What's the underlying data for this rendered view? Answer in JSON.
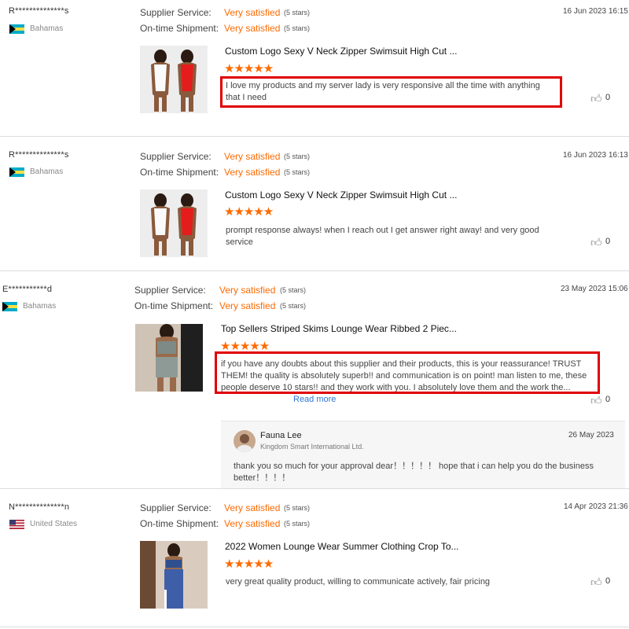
{
  "reviews": [
    {
      "user": "R**************s",
      "country": "Bahamas",
      "supplier_label": "Supplier Service:",
      "supplier_value": "Very satisfied",
      "supplier_stars": "(5 stars)",
      "shipment_label": "On-time Shipment:",
      "shipment_value": "Very satisfied",
      "shipment_stars": "(5 stars)",
      "date": "16 Jun 2023 16:15",
      "product_title": "Custom Logo Sexy V Neck Zipper Swimsuit High Cut ...",
      "rating_stars": "★★★★★",
      "comment": "I love my products and my server lady is very responsive all the time with anything that I need",
      "likes": "0"
    },
    {
      "user": "R**************s",
      "country": "Bahamas",
      "supplier_label": "Supplier Service:",
      "supplier_value": "Very satisfied",
      "supplier_stars": "(5 stars)",
      "shipment_label": "On-time Shipment:",
      "shipment_value": "Very satisfied",
      "shipment_stars": "(5 stars)",
      "date": "16 Jun 2023 16:13",
      "product_title": "Custom Logo Sexy V Neck Zipper Swimsuit High Cut ...",
      "rating_stars": "★★★★★",
      "comment": "prompt response always! when I reach out I get answer right away! and very good service",
      "likes": "0"
    },
    {
      "user": "E***********d",
      "country": "Bahamas",
      "supplier_label": "Supplier Service:",
      "supplier_value": "Very satisfied",
      "supplier_stars": "(5 stars)",
      "shipment_label": "On-time Shipment:",
      "shipment_value": "Very satisfied",
      "shipment_stars": "(5 stars)",
      "date": "23 May 2023 15:06",
      "product_title": "Top Sellers Striped Skims Lounge Wear Ribbed 2 Piec...",
      "rating_stars": "★★★★★",
      "comment": "if you have any doubts about this supplier and their products, this is your reassurance! TRUST THEM! the quality is absolutely superb!! and communication is on point! man listen to me, these people deserve 10 stars!! and they work with you. I absolutely love them and the work the...",
      "read_more": "Read more",
      "likes": "0",
      "reply": {
        "name": "Fauna Lee",
        "company": "Kingdom Smart International Ltd.",
        "date": "26 May 2023",
        "text": "thank you so much for your approval dear！！！！！ hope that i can help you do the business better！！！！"
      }
    },
    {
      "user": "N**************n",
      "country": "United States",
      "supplier_label": "Supplier Service:",
      "supplier_value": "Very satisfied",
      "supplier_stars": "(5 stars)",
      "shipment_label": "On-time Shipment:",
      "shipment_value": "Very satisfied",
      "shipment_stars": "(5 stars)",
      "date": "14 Apr 2023 21:36",
      "product_title": "2022 Women Lounge Wear Summer Clothing Crop To...",
      "rating_stars": "★★★★★",
      "comment": "very great quality product, willing to communicate actively, fair pricing",
      "likes": "0"
    }
  ],
  "colors": {
    "accent": "#ff6a00",
    "highlight": "#e00000",
    "link": "#2f75d6"
  },
  "icons": {
    "like": "thumbs-up-icon"
  }
}
